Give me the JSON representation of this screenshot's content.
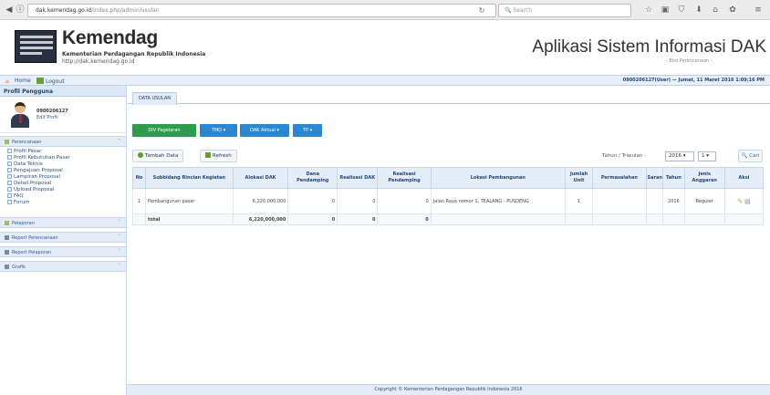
{
  "browser": {
    "url_host": "dak.kemendag.go.id",
    "url_path": "/index.php/admin/usulan",
    "search_placeholder": "Search"
  },
  "header": {
    "brand": "Kemendag",
    "brand_sub": "Kementerian Perdagangan Republik Indonesia",
    "brand_url": "http://dak.kemendag.go.id",
    "app_title": "Aplikasi Sistem Informasi DAK",
    "app_sub": "- Biro Perencanaan -"
  },
  "menubar": {
    "home": "Home",
    "logout": "Logout",
    "user_info": "0900206127(User) — Jumat, 11 Maret 2016 1:09:16 PM"
  },
  "sidebar": {
    "title": "Profil Pengguna",
    "profile_name": "0900206127",
    "profile_edit": "Edit Profil",
    "sections": [
      {
        "label": "Perencanaan",
        "items": [
          "Profil Pasar",
          "Profil Kebutuhan Pasar",
          "Data Teknis",
          "Pengajuan Proposal",
          "Lampiran Proposal",
          "Detail Proposal",
          "Upload Proposal",
          "FAQ",
          "Forum"
        ]
      },
      {
        "label": "Pelaporan"
      },
      {
        "label": "Report Perencanaan"
      },
      {
        "label": "Report Pelaporan"
      },
      {
        "label": "Grafik"
      }
    ]
  },
  "content": {
    "tab": "DATA USULAN",
    "buttons": [
      "DIV Pagelaran",
      "TMQ ▾",
      "DAK Aktual ▾",
      "TP ▾"
    ],
    "tools": {
      "add": "Tambah Data",
      "refresh": "Refresh",
      "year_label": "Tahun / Triwulan :",
      "year": "2016",
      "quarter": "1",
      "search": "Cari"
    },
    "table": {
      "columns": [
        "No",
        "Subbidang Rincian Kegiatan",
        "Alokasi DAK",
        "Dana Pendamping",
        "Realisasi DAK",
        "Realisasi Pendamping",
        "Lokasi Pembangunan",
        "Jumlah Unit",
        "Permasalahan",
        "Saran",
        "Tahun",
        "Jenis Anggaran",
        "Aksi"
      ],
      "rows": [
        {
          "no": "1",
          "kegiatan": "Pembangunan pasar",
          "alokasi": "6,220,000,000",
          "pendamping": "0",
          "realisasi_dak": "0",
          "realisasi_pendamping": "0",
          "lokasi": "Jalan Raya nomor 1, TEALANG - PUSDENG",
          "unit": "1",
          "permasalahan": "",
          "saran": "",
          "tahun": "2016",
          "jenis": "Reguler"
        }
      ],
      "total": {
        "label": "total",
        "alokasi": "6,220,000,000",
        "pendamping": "0",
        "realisasi_dak": "0",
        "realisasi_pendamping": "0"
      }
    },
    "footer": "Copyright © Kementerian Perdagangan Republik Indonesia 2016"
  },
  "colors": {
    "button_green": "#2e9b4e",
    "button_blue": "#2d86d0",
    "accent": "#23467a"
  }
}
